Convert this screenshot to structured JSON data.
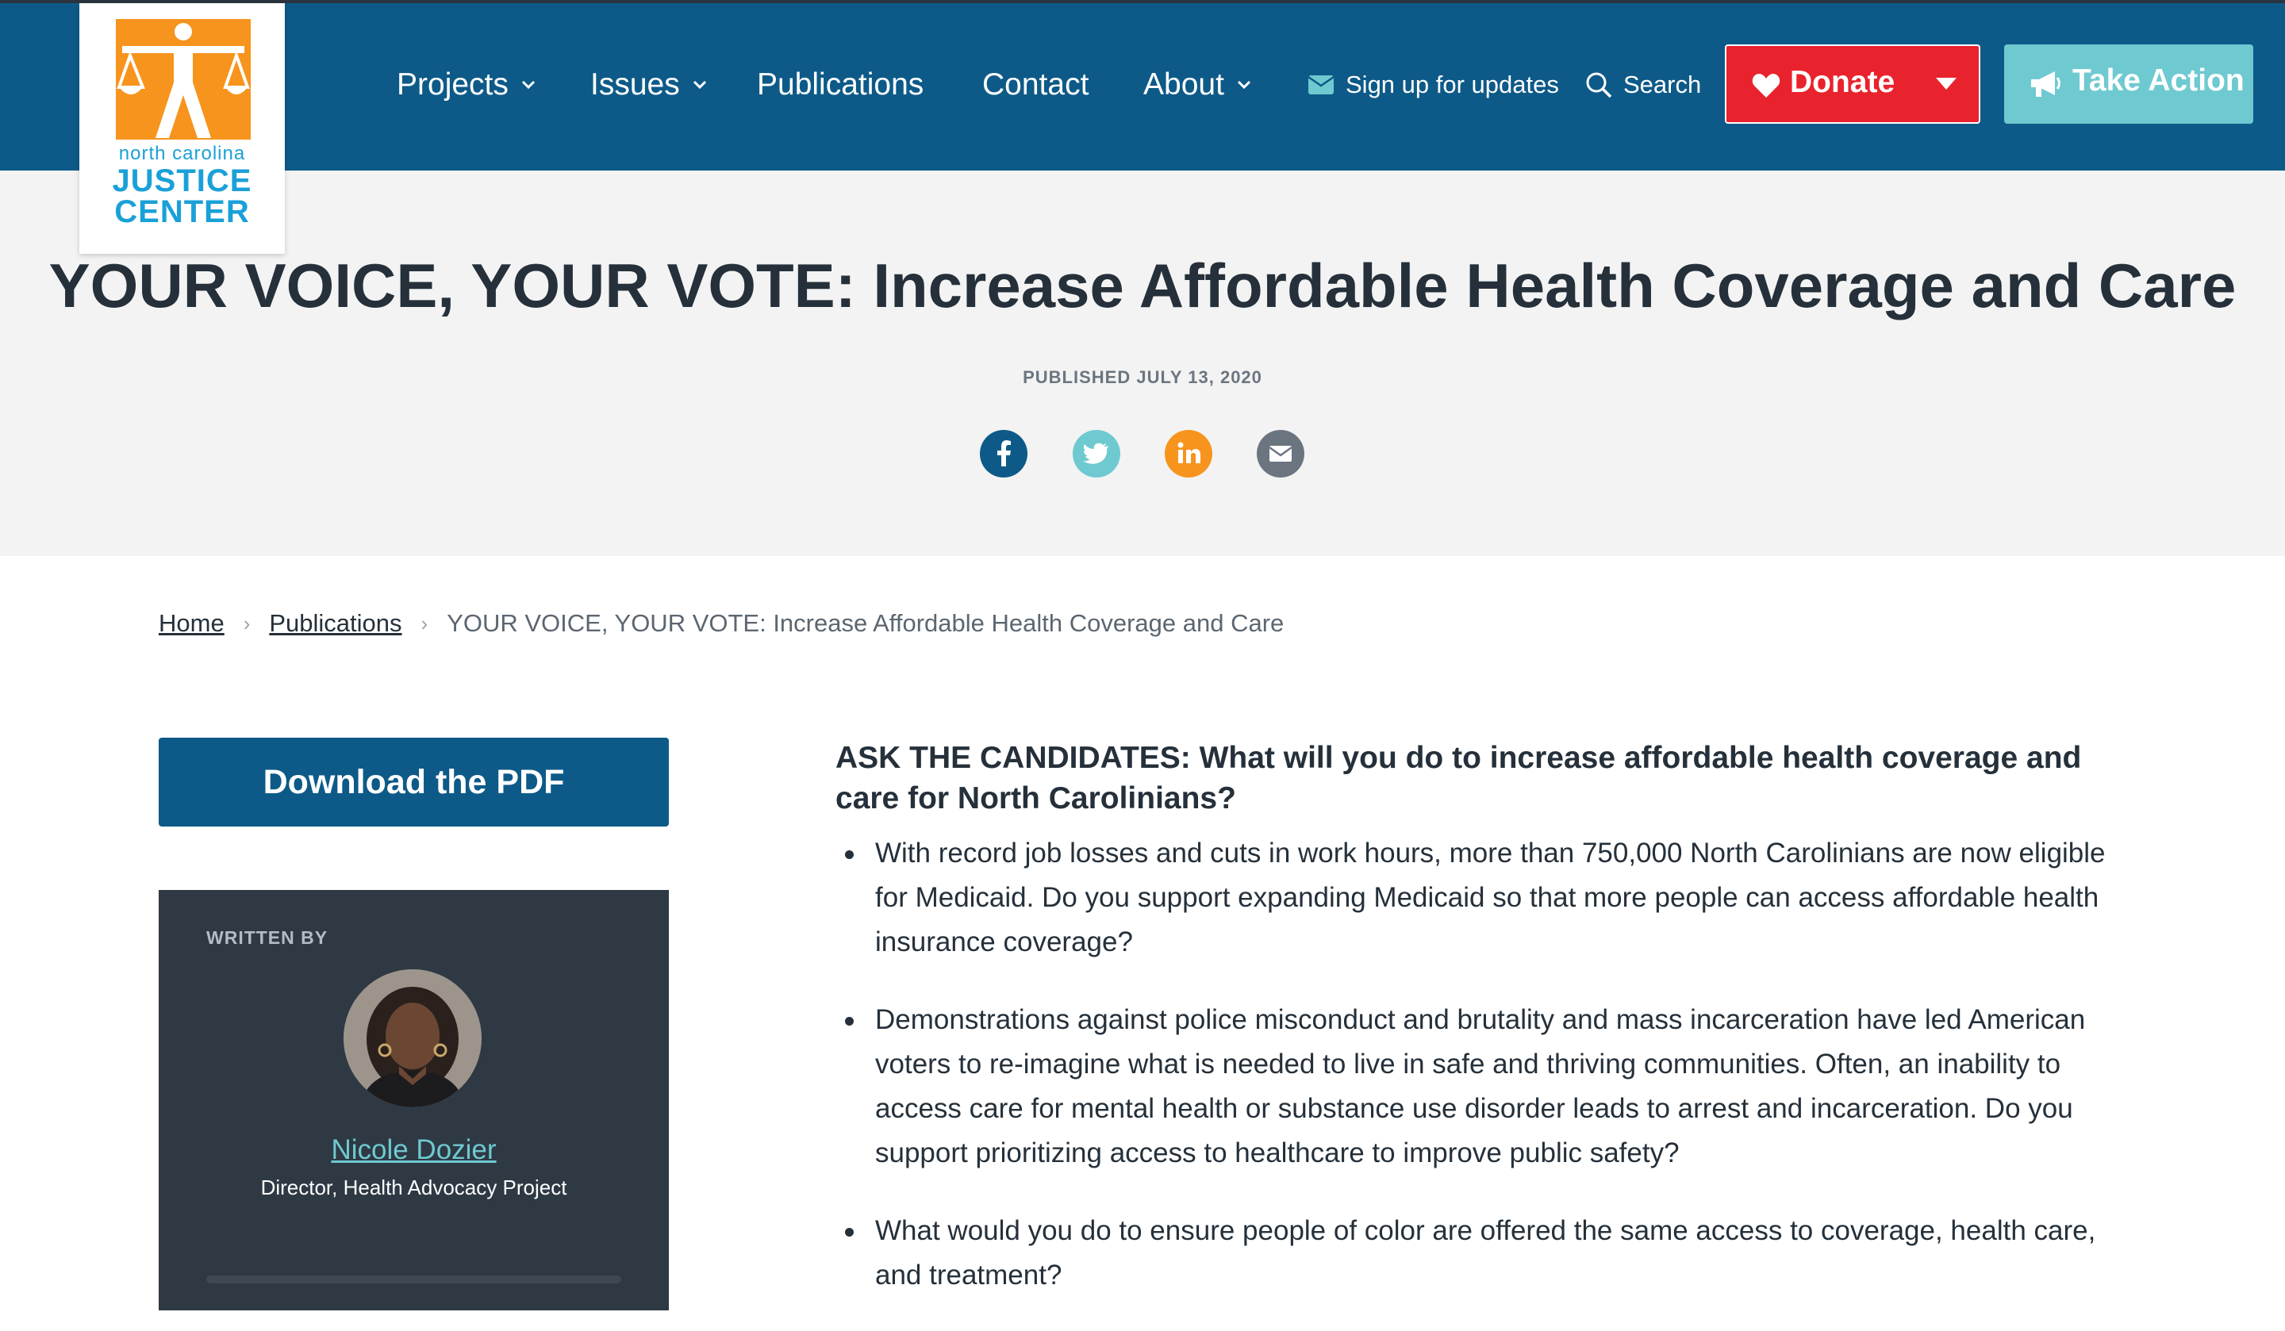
{
  "header": {
    "logo": {
      "line_small": "north carolina",
      "line1": "JUSTICE",
      "line2": "CENTER",
      "colors": {
        "orange": "#f7941d",
        "blue": "#1aa0d8"
      }
    },
    "nav": [
      {
        "label": "Projects",
        "has_dropdown": true
      },
      {
        "label": "Issues",
        "has_dropdown": true
      },
      {
        "label": "Publications",
        "has_dropdown": false
      },
      {
        "label": "Contact",
        "has_dropdown": false
      },
      {
        "label": "About",
        "has_dropdown": true
      }
    ],
    "signup_label": "Sign up for updates",
    "search_label": "Search",
    "donate_label": "Donate",
    "take_action_label": "Take Action",
    "colors": {
      "bar": "#0d5a88",
      "donate": "#e8232d",
      "take_action": "#6fc9d0"
    }
  },
  "hero": {
    "title": "YOUR VOICE, YOUR VOTE: Increase Affordable Health Coverage and Care",
    "published": "PUBLISHED JULY 13, 2020",
    "share": [
      {
        "icon": "facebook-icon",
        "color": "#0d5a88"
      },
      {
        "icon": "twitter-icon",
        "color": "#6fc9d0"
      },
      {
        "icon": "linkedin-icon",
        "color": "#f7941d"
      },
      {
        "icon": "email-icon",
        "color": "#6b7580"
      }
    ]
  },
  "breadcrumb": {
    "home": "Home",
    "publications": "Publications",
    "current": "YOUR VOICE, YOUR VOTE: Increase Affordable Health Coverage and Care"
  },
  "sidebar": {
    "pdf_button": "Download the PDF",
    "written_by": "WRITTEN BY",
    "author_name": "Nicole Dozier",
    "author_role": "Director, Health Advocacy Project"
  },
  "article": {
    "ask": "ASK THE CANDIDATES: What will you do to increase affordable health coverage and care for North Carolinians?",
    "questions": [
      "With record job losses and cuts in work hours, more than 750,000 North Carolinians are now eligible for Medicaid. Do you support expanding Medicaid so that more people can access affordable health insurance coverage?",
      "Demonstrations against police misconduct and brutality and mass incarceration have led American voters to re-imagine what is needed to live in safe and thriving communities. Often, an inability to access care for mental health or substance use disorder leads to arrest and incarceration. Do you support prioritizing access to healthcare to improve public safety?",
      "What would you do to ensure people of color are offered the same access to coverage, health care, and treatment?"
    ]
  }
}
